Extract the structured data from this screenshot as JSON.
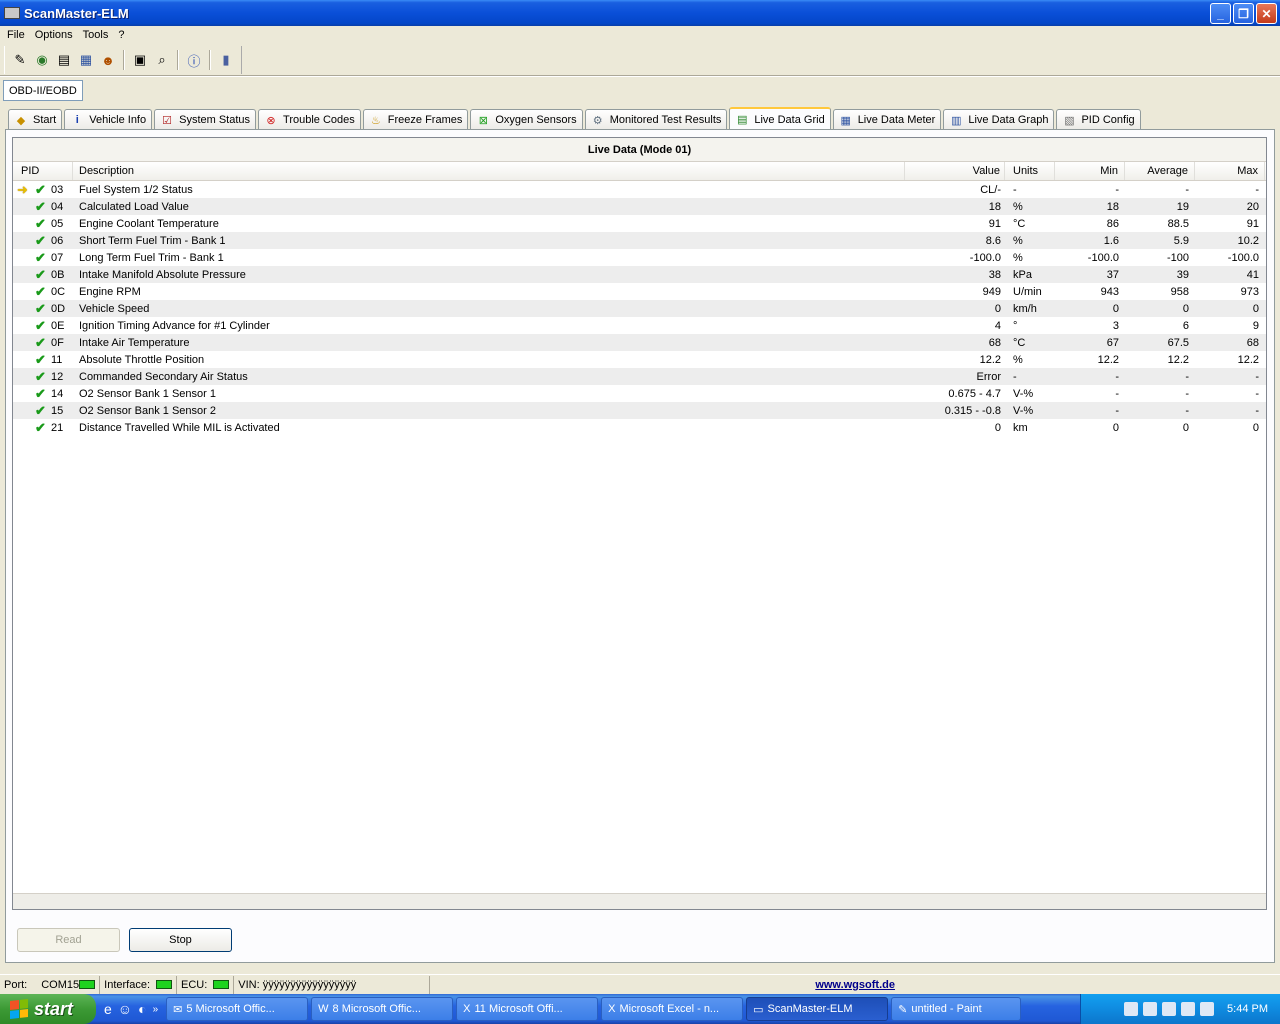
{
  "window": {
    "title": "ScanMaster-ELM"
  },
  "menu": {
    "items": [
      "File",
      "Options",
      "Tools",
      "?"
    ]
  },
  "protocol_tab": "OBD-II/EOBD",
  "tabs": [
    {
      "label": "Start",
      "icon": "folder-icon"
    },
    {
      "label": "Vehicle Info",
      "icon": "info-icon"
    },
    {
      "label": "System Status",
      "icon": "checklist-icon"
    },
    {
      "label": "Trouble Codes",
      "icon": "error-icon"
    },
    {
      "label": "Freeze Frames",
      "icon": "freeze-icon"
    },
    {
      "label": "Oxygen Sensors",
      "icon": "sensor-icon"
    },
    {
      "label": "Monitored Test Results",
      "icon": "gear-icon"
    },
    {
      "label": "Live Data Grid",
      "icon": "grid-icon"
    },
    {
      "label": "Live Data Meter",
      "icon": "meter-icon"
    },
    {
      "label": "Live Data Graph",
      "icon": "graph-icon"
    },
    {
      "label": "PID Config",
      "icon": "config-icon"
    }
  ],
  "grid": {
    "title": "Live Data (Mode 01)",
    "headers": {
      "pid": "PID",
      "description": "Description",
      "value": "Value",
      "units": "Units",
      "min": "Min",
      "average": "Average",
      "max": "Max"
    },
    "rows": [
      {
        "pid": "03",
        "description": "Fuel System 1/2 Status",
        "value": "CL/-",
        "units": "-",
        "min": "-",
        "average": "-",
        "max": "-"
      },
      {
        "pid": "04",
        "description": "Calculated Load Value",
        "value": "18",
        "units": "%",
        "min": "18",
        "average": "19",
        "max": "20"
      },
      {
        "pid": "05",
        "description": "Engine Coolant Temperature",
        "value": "91",
        "units": "°C",
        "min": "86",
        "average": "88.5",
        "max": "91"
      },
      {
        "pid": "06",
        "description": "Short Term Fuel Trim - Bank 1",
        "value": "8.6",
        "units": "%",
        "min": "1.6",
        "average": "5.9",
        "max": "10.2"
      },
      {
        "pid": "07",
        "description": "Long Term Fuel Trim - Bank 1",
        "value": "-100.0",
        "units": "%",
        "min": "-100.0",
        "average": "-100",
        "max": "-100.0"
      },
      {
        "pid": "0B",
        "description": "Intake Manifold Absolute Pressure",
        "value": "38",
        "units": "kPa",
        "min": "37",
        "average": "39",
        "max": "41"
      },
      {
        "pid": "0C",
        "description": "Engine RPM",
        "value": "949",
        "units": "U/min",
        "min": "943",
        "average": "958",
        "max": "973"
      },
      {
        "pid": "0D",
        "description": "Vehicle Speed",
        "value": "0",
        "units": "km/h",
        "min": "0",
        "average": "0",
        "max": "0"
      },
      {
        "pid": "0E",
        "description": "Ignition Timing Advance for #1 Cylinder",
        "value": "4",
        "units": "°",
        "min": "3",
        "average": "6",
        "max": "9"
      },
      {
        "pid": "0F",
        "description": "Intake Air Temperature",
        "value": "68",
        "units": "°C",
        "min": "67",
        "average": "67.5",
        "max": "68"
      },
      {
        "pid": "11",
        "description": "Absolute Throttle Position",
        "value": "12.2",
        "units": "%",
        "min": "12.2",
        "average": "12.2",
        "max": "12.2"
      },
      {
        "pid": "12",
        "description": "Commanded Secondary Air Status",
        "value": "Error",
        "units": "-",
        "min": "-",
        "average": "-",
        "max": "-"
      },
      {
        "pid": "14",
        "description": "O2 Sensor Bank 1 Sensor 1",
        "value": "0.675 - 4.7",
        "units": "V-%",
        "min": "-",
        "average": "-",
        "max": "-"
      },
      {
        "pid": "15",
        "description": "O2 Sensor Bank 1 Sensor 2",
        "value": "0.315 - -0.8",
        "units": "V-%",
        "min": "-",
        "average": "-",
        "max": "-"
      },
      {
        "pid": "21",
        "description": "Distance Travelled While MIL is Activated",
        "value": "0",
        "units": "km",
        "min": "0",
        "average": "0",
        "max": "0"
      }
    ]
  },
  "buttons": {
    "read": "Read",
    "stop": "Stop"
  },
  "status": {
    "port_label": "Port:",
    "port_value": "COM15",
    "interface_label": "Interface:",
    "ecu_label": "ECU:",
    "vin": "VIN: ÿÿÿÿÿÿÿÿÿÿÿÿÿÿÿÿÿ",
    "link": "www.wgsoft.de"
  },
  "taskbar": {
    "start": "start",
    "tasks": [
      {
        "label": "5 Microsoft Offic...",
        "active": false
      },
      {
        "label": "8 Microsoft Offic...",
        "active": false
      },
      {
        "label": "11 Microsoft Offi...",
        "active": false
      },
      {
        "label": "Microsoft Excel - n...",
        "active": false
      },
      {
        "label": "ScanMaster-ELM",
        "active": true
      },
      {
        "label": "untitled - Paint",
        "active": false
      }
    ],
    "clock": "5:44 PM"
  }
}
